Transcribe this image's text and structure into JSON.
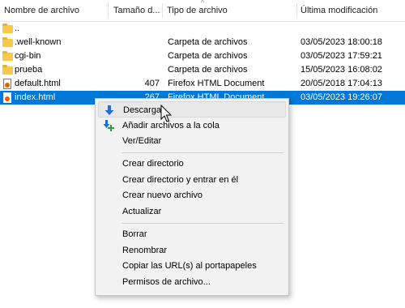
{
  "columns": {
    "name": "Nombre de archivo",
    "size": "Tamaño d...",
    "type": "Tipo de archivo",
    "modified": "Última modificación"
  },
  "files": [
    {
      "name": "..",
      "size": "",
      "type": "",
      "modified": "",
      "icon": "folder-icon"
    },
    {
      "name": ".well-known",
      "size": "",
      "type": "Carpeta de archivos",
      "modified": "03/05/2023 18:00:18",
      "icon": "folder-icon"
    },
    {
      "name": "cgi-bin",
      "size": "",
      "type": "Carpeta de archivos",
      "modified": "03/05/2023 17:59:21",
      "icon": "folder-icon"
    },
    {
      "name": "prueba",
      "size": "",
      "type": "Carpeta de archivos",
      "modified": "15/05/2023 16:08:02",
      "icon": "folder-icon"
    },
    {
      "name": "default.html",
      "size": "407",
      "type": "Firefox HTML Document",
      "modified": "20/05/2018 17:04:13",
      "icon": "html-file-icon"
    },
    {
      "name": "index.html",
      "size": "267",
      "type": "Firefox HTML Document",
      "modified": "03/05/2023 19:26:07",
      "icon": "html-file-icon",
      "selected": true
    }
  ],
  "context_menu": {
    "download": "Descargar",
    "add_to_queue": "Añadir archivos a la cola",
    "view_edit": "Ver/Editar",
    "create_dir": "Crear directorio",
    "create_dir_enter": "Crear directorio y entrar en él",
    "create_file": "Crear nuevo archivo",
    "refresh": "Actualizar",
    "delete": "Borrar",
    "rename": "Renombrar",
    "copy_urls": "Copiar las URL(s) al portapapeles",
    "permissions": "Permisos de archivo..."
  },
  "colors": {
    "selection": "#0078d7",
    "folder": "#f7c948",
    "download_arrow": "#1e6fd9",
    "queue_arrow": "#1e6fd9",
    "queue_plus": "#2ea043"
  }
}
